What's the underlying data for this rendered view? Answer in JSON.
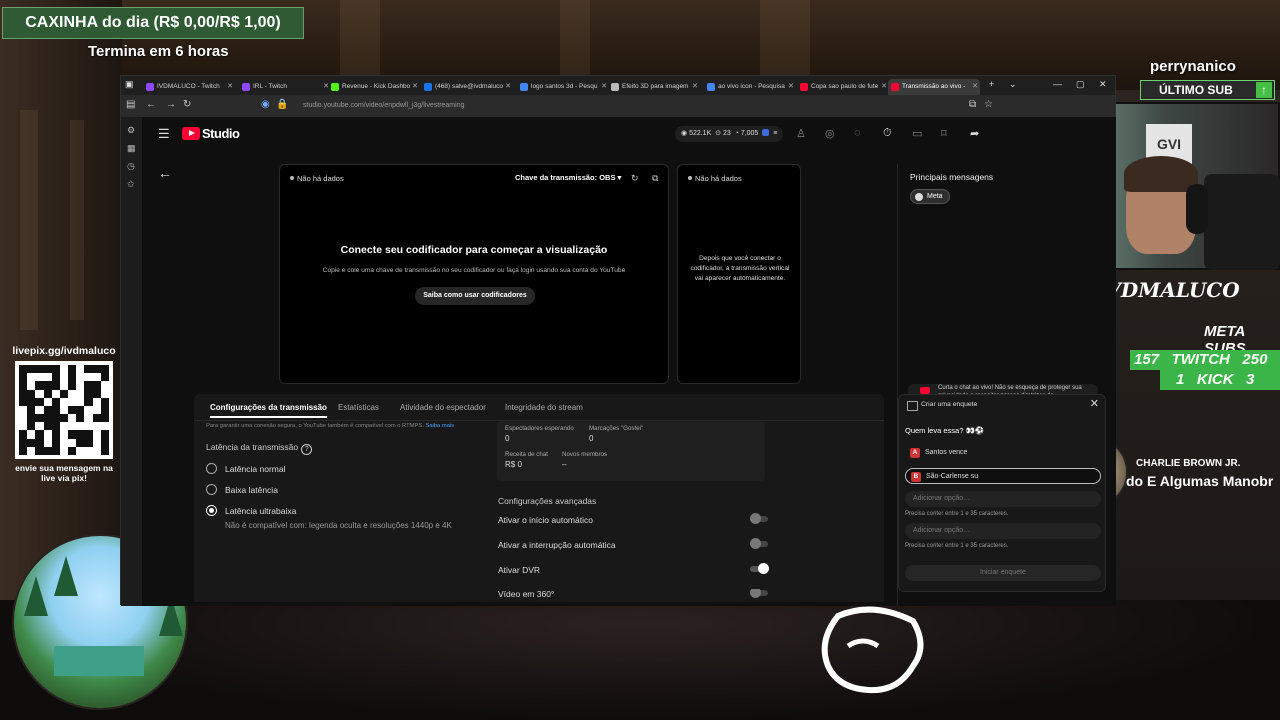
{
  "overlay": {
    "caixinha": "CAXINHA do dia (R$ 0,00/R$ 1,00)",
    "termina": "Termina em 6 horas",
    "livepix_url": "livepix.gg/ivdmaluco",
    "livepix_msg": "envie sua mensagem na live via pix!",
    "streamer_name": "perrynanico",
    "ultimo_sub": "ÚLTIMO SUB",
    "signature": "IVDMALUCO",
    "meta_subs": "META SUBS",
    "twitch_row": {
      "current": "157",
      "label": "TWITCH",
      "goal": "250"
    },
    "kick_row": {
      "current": "1",
      "label": "KICK",
      "goal": "3"
    },
    "music_artist": "CHARLIE BROWN JR.",
    "music_song": "do E Algumas Manobr",
    "webcam_poster": "GVI"
  },
  "browser": {
    "tabs": [
      {
        "label": "IVDMALUCO - Twitch",
        "color": "#9146ff"
      },
      {
        "label": "IRL - Twitch",
        "color": "#9146ff"
      },
      {
        "label": "Revenue - Kick Dashbo",
        "color": "#53fc18"
      },
      {
        "label": "(468) salve@ivdmaluco",
        "color": "#1a73e8"
      },
      {
        "label": "logo santos 3d - Pesqu",
        "color": "#4285f4"
      },
      {
        "label": "Efeito 3D para imagem",
        "color": "#bbbbbb"
      },
      {
        "label": "ao vivo icon - Pesquisa",
        "color": "#4285f4"
      },
      {
        "label": "Copa sao paulo de fute",
        "color": "#ff0033"
      },
      {
        "label": "Transmissão ao vivo -",
        "color": "#ff0033"
      }
    ],
    "url": "studio.youtube.com/video/enpdwll_j3g/livestreaming"
  },
  "studio": {
    "brand": "Studio",
    "stats": {
      "views": "522.1K",
      "viewers": "23",
      "likes": "7,005"
    },
    "preview": {
      "nodata": "Não há dados",
      "stream_key": "Chave da transmissão: OBS",
      "title": "Conecte seu codificador para começar a visualização",
      "subtitle": "Copie e cole uma chave de transmissão no seu codificador ou faça login usando sua conta do YouTube",
      "learn_button": "Saiba como usar codificadores"
    },
    "vertical": {
      "nodata": "Não há dados",
      "text": "Depois que você conectar o codificador, a transmissão vertical vai aparecer automaticamente."
    },
    "chat": {
      "title": "Principais mensagens",
      "chip": "Meta",
      "pinned": "Curta o chat ao vivo! Não se esqueça de proteger sua privacidade e respeitar nossas diretrizes da"
    },
    "poll": {
      "header": "Criar uma enquete",
      "question": "Quem leva essa? 👀⚽",
      "option_a": "Santos vence",
      "option_b": "São-Carlense su",
      "placeholder": "Adicionar opção...",
      "hint": "Precisa conter entre 1 e 35 caracteres.",
      "start": "Iniciar enquete"
    },
    "bottom_tabs": [
      "Configurações da transmissão",
      "Estatísticas",
      "Atividade do espectador",
      "Integridade do stream"
    ],
    "settings": {
      "note": "Para garantir uma conexão segura, o YouTube também é compatível com o RTMPS.",
      "note_link": "Saiba mais",
      "latency_label": "Latência da transmissão",
      "latency_options": [
        "Latência normal",
        "Baixa latência",
        "Latência ultrabaixa"
      ],
      "latency_selected": "Latência ultrabaixa",
      "latency_note": "Não é compatível com: legenda oculta e resoluções 1440p e 4K"
    },
    "stats_box": {
      "waiting_label": "Espectadores esperando",
      "waiting_value": "0",
      "likes_label": "Marcações \"Gostei\"",
      "likes_value": "0",
      "revenue_label": "Receita de chat",
      "revenue_value": "R$ 0",
      "members_label": "Novos membros",
      "members_value": "–"
    },
    "advanced": {
      "title": "Configurações avançadas",
      "autostart": "Ativar o início automático",
      "autostop": "Ativar a interrupção automática",
      "dvr": "Ativar DVR",
      "video360": "Vídeo em 360°"
    }
  }
}
